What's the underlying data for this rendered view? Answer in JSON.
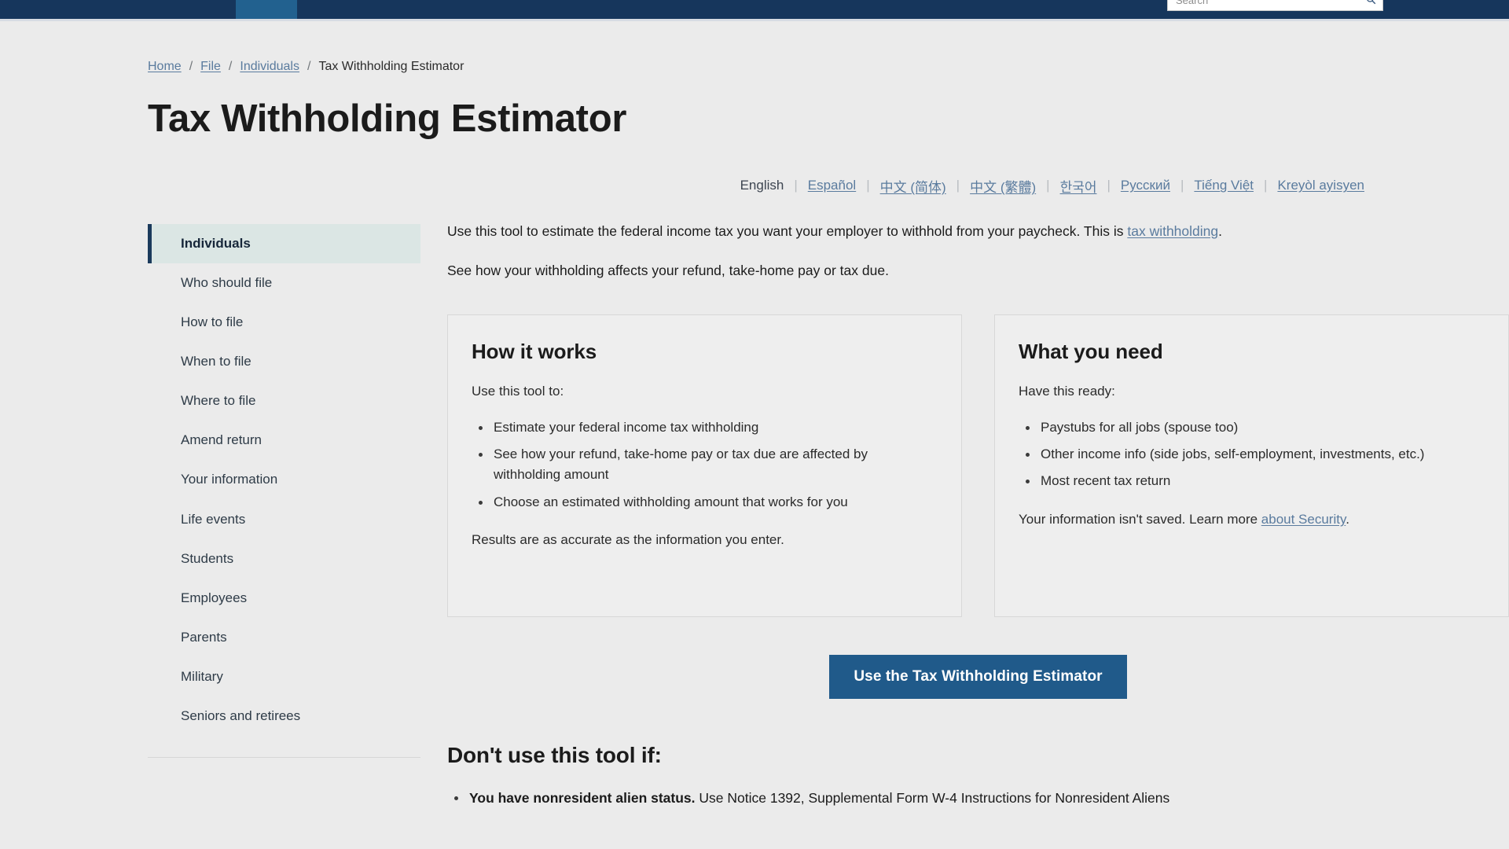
{
  "header": {
    "search": {
      "placeholder": "Search",
      "value": "",
      "icon": "search-icon"
    },
    "tabs": [
      "",
      "",
      ""
    ]
  },
  "breadcrumb": {
    "items": [
      {
        "label": "Home",
        "link": true
      },
      {
        "label": "File",
        "link": true
      },
      {
        "label": "Individuals",
        "link": true
      },
      {
        "label": "Tax Withholding Estimator",
        "link": false
      }
    ],
    "separator": "/"
  },
  "page_title": "Tax Withholding Estimator",
  "languages": {
    "items": [
      {
        "label": "English",
        "active": true
      },
      {
        "label": "Español",
        "active": false
      },
      {
        "label": "中文 (简体)",
        "active": false
      },
      {
        "label": "中文 (繁體)",
        "active": false
      },
      {
        "label": "한국어",
        "active": false
      },
      {
        "label": "Русский",
        "active": false
      },
      {
        "label": "Tiếng Việt",
        "active": false
      },
      {
        "label": "Kreyòl ayisyen",
        "active": false
      }
    ],
    "divider": "|"
  },
  "sidebar": {
    "items": [
      {
        "label": "Individuals",
        "active": true
      },
      {
        "label": "Who should file",
        "active": false
      },
      {
        "label": "How to file",
        "active": false
      },
      {
        "label": "When to file",
        "active": false
      },
      {
        "label": "Where to file",
        "active": false
      },
      {
        "label": "Amend return",
        "active": false
      },
      {
        "label": "Your information",
        "active": false
      },
      {
        "label": "Life events",
        "active": false
      },
      {
        "label": "Students",
        "active": false
      },
      {
        "label": "Employees",
        "active": false
      },
      {
        "label": "Parents",
        "active": false
      },
      {
        "label": "Military",
        "active": false
      },
      {
        "label": "Seniors and retirees",
        "active": false
      }
    ]
  },
  "intro": {
    "para1_before": "Use this tool to estimate the federal income tax you want your employer to withhold from your paycheck. This is ",
    "para1_link": "tax withholding",
    "para1_after": ".",
    "para2": "See how your withholding affects your refund, take-home pay or tax due."
  },
  "cards": [
    {
      "title": "How it works",
      "lead": "Use this tool to:",
      "bullets": [
        "Estimate your federal income tax withholding",
        "See how your refund, take-home pay or tax due are affected by withholding amount",
        "Choose an estimated withholding amount that works for you"
      ],
      "note_before": "Results are as accurate as the information you enter.",
      "note_link": "",
      "note_after": ""
    },
    {
      "title": "What you need",
      "lead": "Have this ready:",
      "bullets": [
        "Paystubs for all jobs (spouse too)",
        "Other income info (side jobs, self-employment, investments, etc.)",
        "Most recent tax return"
      ],
      "note_before": "Your information isn't saved. Learn more ",
      "note_link": "about Security",
      "note_after": "."
    }
  ],
  "cta": {
    "label": "Use the Tax Withholding Estimator"
  },
  "dont_use": {
    "title": "Don't use this tool if:",
    "bullets": [
      {
        "bold": "You have nonresident alien status.",
        "rest": " Use Notice 1392, Supplemental Form W-4 Instructions for Nonresident Aliens"
      }
    ]
  },
  "colors": {
    "header_bg": "#16365c",
    "header_tab_active": "#22618f",
    "page_bg": "#ebebeb",
    "link": "#5a7b9e",
    "sidebar_active_bg": "#dbe6e4",
    "sidebar_active_bar": "#1b3a5c",
    "cta_bg": "#205a8a",
    "card_border": "#d8d8d8",
    "card_bg": "#eeeeee"
  }
}
